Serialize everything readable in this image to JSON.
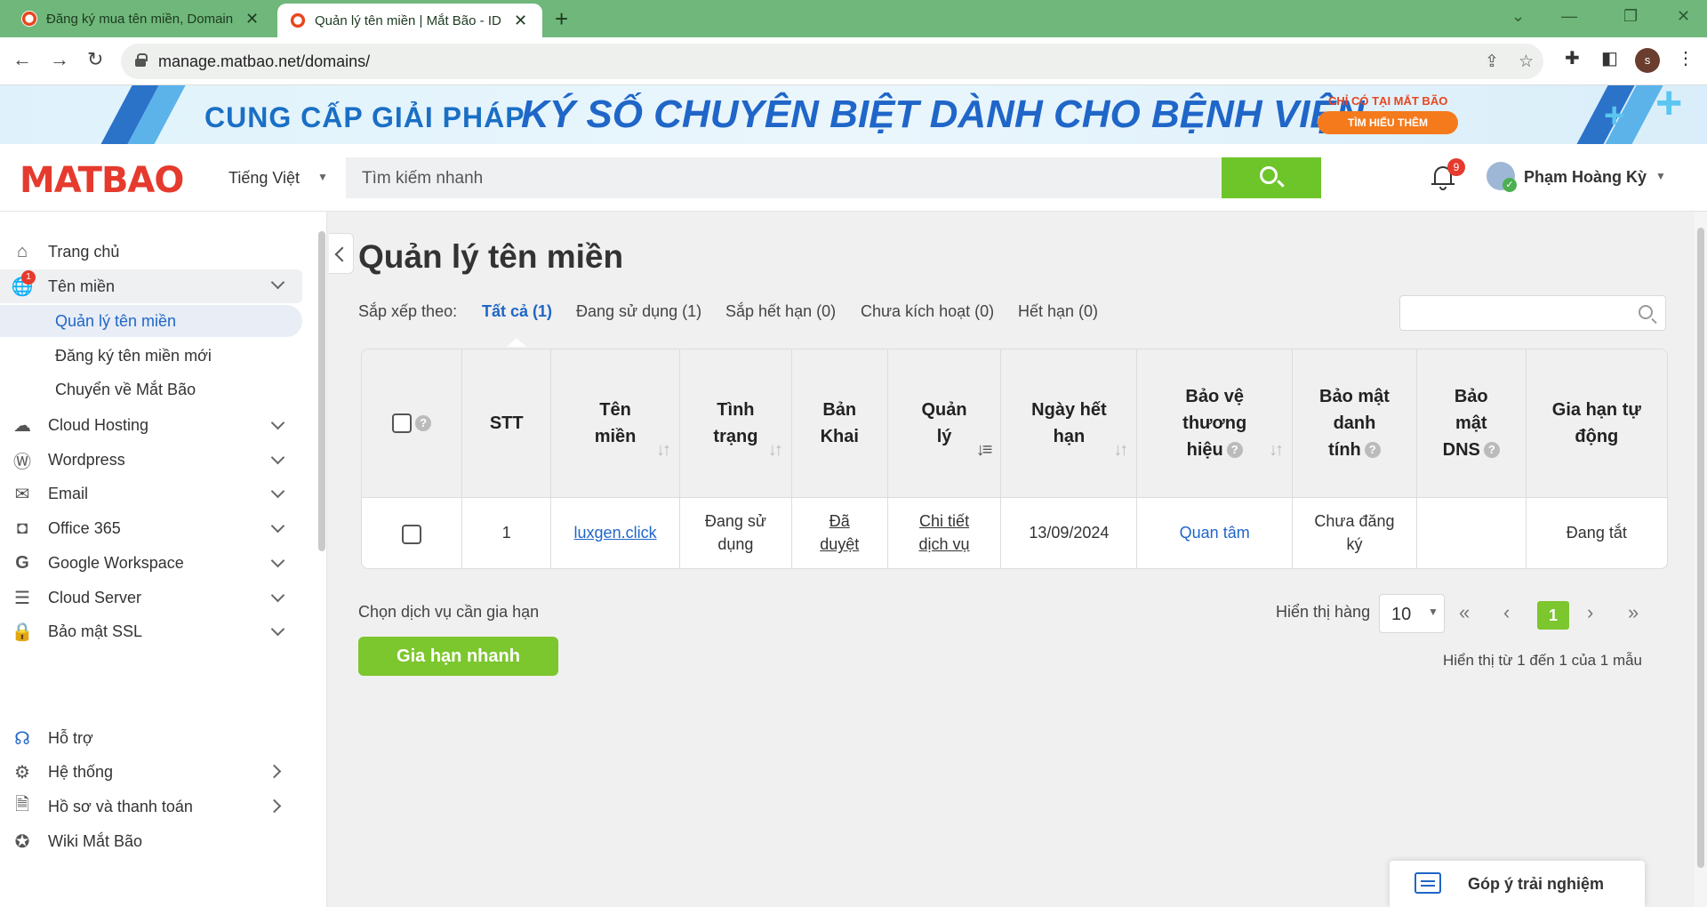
{
  "browser": {
    "tabs": [
      {
        "title": "Đăng ký mua tên miền, Domain,",
        "close": "✕"
      },
      {
        "title": "Quản lý tên miền | Mắt Bão - ID M",
        "close": "✕"
      }
    ],
    "new_tab": "+",
    "url": "manage.matbao.net/domains/",
    "profile_initial": "s"
  },
  "banner": {
    "line1": "CUNG CẤP GIẢI PHÁP",
    "line2": "KÝ SỐ CHUYÊN BIỆT DÀNH CHO BỆNH VIỆN",
    "badge": "CHỈ CÓ TẠI MẮT BÃO",
    "cta": "TÌM HIỂU THÊM"
  },
  "header": {
    "logo": "MATBAO",
    "language": "Tiếng Việt",
    "search_placeholder": "Tìm kiếm nhanh",
    "notification_count": "9",
    "user_name": "Phạm Hoàng Kỳ"
  },
  "sidebar": {
    "items": [
      {
        "label": "Trang chủ",
        "icon": "home-icon"
      },
      {
        "label": "Tên miền",
        "icon": "globe-icon",
        "badge": "1"
      },
      {
        "label": "Cloud Hosting",
        "icon": "cloud-icon"
      },
      {
        "label": "Wordpress",
        "icon": "wordpress-icon"
      },
      {
        "label": "Email",
        "icon": "mail-icon"
      },
      {
        "label": "Office 365",
        "icon": "office-icon"
      },
      {
        "label": "Google Workspace",
        "icon": "google-icon"
      },
      {
        "label": "Cloud Server",
        "icon": "server-icon"
      },
      {
        "label": "Bảo mật SSL",
        "icon": "ssl-lock-icon"
      },
      {
        "label": "Hỗ trợ",
        "icon": "headset-icon"
      },
      {
        "label": "Hệ thống",
        "icon": "gear-icon"
      },
      {
        "label": "Hồ sơ và thanh toán",
        "icon": "document-icon"
      },
      {
        "label": "Wiki Mắt Bão",
        "icon": "compass-icon"
      }
    ],
    "sub_items": [
      {
        "label": "Quản lý tên miền"
      },
      {
        "label": "Đăng ký tên miền mới"
      },
      {
        "label": "Chuyển về Mắt Bão"
      }
    ]
  },
  "main": {
    "title": "Quản lý tên miền",
    "sort_label": "Sắp xếp theo:",
    "filters": [
      "Tất cả (1)",
      "Đang sử dụng (1)",
      "Sắp hết hạn (0)",
      "Chưa kích hoạt (0)",
      "Hết hạn (0)"
    ],
    "table": {
      "headers": {
        "stt": "STT",
        "domain": [
          "Tên",
          "miền"
        ],
        "status": [
          "Tình",
          "trạng"
        ],
        "declaration": [
          "Bản",
          "Khai"
        ],
        "manage": [
          "Quản",
          "lý"
        ],
        "expiry": [
          "Ngày hết",
          "hạn"
        ],
        "brand": [
          "Bảo vệ",
          "thương",
          "hiệu"
        ],
        "privacy": [
          "Bảo mật",
          "danh",
          "tính"
        ],
        "dns": [
          "Bảo",
          "mật",
          "DNS"
        ],
        "autorenew": [
          "Gia hạn tự",
          "động"
        ]
      },
      "rows": [
        {
          "stt": "1",
          "domain": "luxgen.click",
          "status": [
            "Đang sử",
            "dụng"
          ],
          "declaration": [
            "Đã",
            "duyệt"
          ],
          "manage": [
            "Chi tiết",
            "dịch vụ"
          ],
          "expiry": "13/09/2024",
          "brand": "Quan tâm",
          "privacy": [
            "Chưa đăng",
            "ký"
          ],
          "dns": "",
          "autorenew": "Đang tắt"
        }
      ]
    },
    "renew_hint": "Chọn dịch vụ cần gia hạn",
    "renew_button": "Gia hạn nhanh",
    "rows_label": "Hiển thị hàng",
    "rows_value": "10",
    "current_page": "1",
    "showing": "Hiển thị từ 1 đến 1 của 1 mẫu"
  },
  "feedback": "Góp ý trải nghiệm"
}
